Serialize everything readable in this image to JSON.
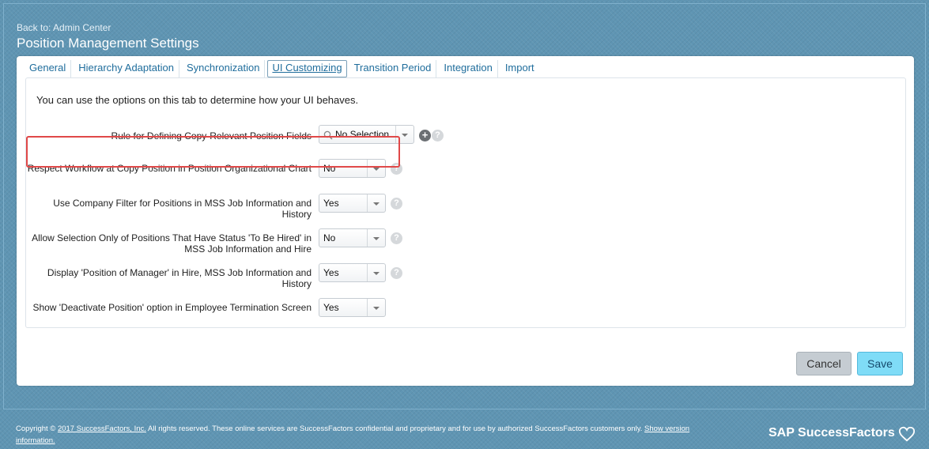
{
  "header": {
    "back_link": "Back to: Admin Center",
    "title": "Position Management Settings"
  },
  "tabs": [
    {
      "label": "General",
      "active": false
    },
    {
      "label": "Hierarchy Adaptation",
      "active": false
    },
    {
      "label": "Synchronization",
      "active": false
    },
    {
      "label": "UI Customizing",
      "active": true
    },
    {
      "label": "Transition Period",
      "active": false
    },
    {
      "label": "Integration",
      "active": false
    },
    {
      "label": "Import",
      "active": false
    }
  ],
  "intro": "You can use the options on this tab to determine how your UI behaves.",
  "settings": [
    {
      "label": "Rule for Defining Copy-Relevant Position Fields",
      "value": "No Selection"
    },
    {
      "label": "Respect Workflow at Copy Position in Position Organizational Chart",
      "value": "No"
    },
    {
      "label": "Use Company Filter for Positions in MSS Job Information and History",
      "value": "Yes"
    },
    {
      "label": "Allow Selection Only of Positions That Have Status 'To Be Hired' in MSS Job Information and Hire",
      "value": "No"
    },
    {
      "label": "Display 'Position of Manager' in Hire, MSS Job Information and History",
      "value": "Yes"
    },
    {
      "label": "Show 'Deactivate Position' option in Employee Termination Screen",
      "value": "Yes"
    }
  ],
  "help_glyph": "?",
  "plus_glyph": "+",
  "buttons": {
    "cancel": "Cancel",
    "save": "Save"
  },
  "footer": {
    "prefix": "Copyright ©",
    "company_link": "2017 SuccessFactors, Inc.",
    "text": "All rights reserved. These online services are SuccessFactors confidential and proprietary and for use by authorized SuccessFactors customers only.",
    "version_link": "Show version information."
  },
  "brand": "SAP SuccessFactors",
  "colors": {
    "accent": "#1f6d9c",
    "save": "#7fdcf7",
    "highlight": "#e04848",
    "background": "#5f95b3"
  }
}
